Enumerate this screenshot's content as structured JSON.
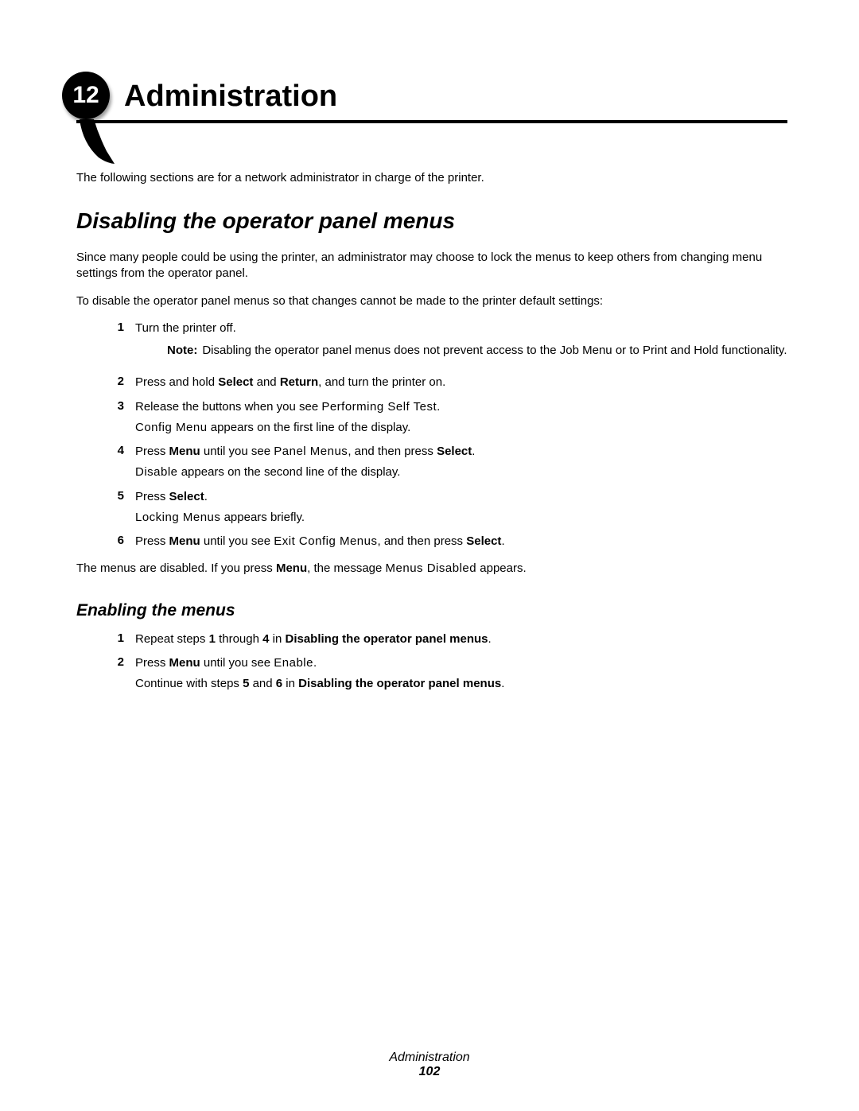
{
  "chapter": {
    "number": "12",
    "title": "Administration"
  },
  "intro": "The following sections are for a network administrator in charge of the printer.",
  "section1": {
    "heading": "Disabling the operator panel menus",
    "p1": "Since many people could be using the printer, an administrator may choose to lock the menus to keep others from changing menu settings from the operator panel.",
    "p2": "To disable the operator panel menus so that changes cannot be made to the printer default settings:",
    "steps": {
      "s1": {
        "num": "1",
        "text": "Turn the printer off."
      },
      "note": {
        "label": "Note:",
        "text": "Disabling the operator panel menus does not prevent access to the Job Menu or to Print and Hold functionality."
      },
      "s2": {
        "num": "2",
        "pre": "Press and hold ",
        "b1": "Select",
        "mid": " and ",
        "b2": "Return",
        "post": ", and turn the printer on."
      },
      "s3": {
        "num": "3",
        "pre": "Release the buttons when you see ",
        "mono1": "Performing Self Test",
        "post": ".",
        "sub_pre": "",
        "sub_mono": "Config Menu",
        "sub_post": " appears on the first line of the display."
      },
      "s4": {
        "num": "4",
        "pre": "Press ",
        "b1": "Menu",
        "mid1": " until you see ",
        "mono1": "Panel Menus",
        "mid2": ", and then press ",
        "b2": "Select",
        "post": ".",
        "sub_mono": "Disable",
        "sub_post": " appears on the second line of the display."
      },
      "s5": {
        "num": "5",
        "pre": "Press ",
        "b1": "Select",
        "post": ".",
        "sub_mono": "Locking Menus",
        "sub_post": " appears briefly."
      },
      "s6": {
        "num": "6",
        "pre": "Press ",
        "b1": "Menu",
        "mid1": " until you see ",
        "mono1": "Exit Config Menus",
        "mid2": ", and then press ",
        "b2": "Select",
        "post": "."
      }
    },
    "closing": {
      "pre": "The menus are disabled. If you press ",
      "b1": "Menu",
      "mid": ", the message ",
      "mono1": "Menus Disabled",
      "post": " appears."
    }
  },
  "section2": {
    "heading": "Enabling the menus",
    "steps": {
      "s1": {
        "num": "1",
        "pre": "Repeat steps ",
        "b1": "1",
        "mid1": " through ",
        "b2": "4",
        "mid2": " in ",
        "b3": "Disabling the operator panel menus",
        "post": "."
      },
      "s2": {
        "num": "2",
        "pre": "Press ",
        "b1": "Menu",
        "mid": " until you see ",
        "mono1": "Enable",
        "post": ".",
        "sub_pre": "Continue with steps ",
        "sub_b1": "5",
        "sub_mid1": " and ",
        "sub_b2": "6",
        "sub_mid2": " in ",
        "sub_b3": "Disabling the operator panel menus",
        "sub_post": "."
      }
    }
  },
  "footer": {
    "title": "Administration",
    "page": "102"
  }
}
